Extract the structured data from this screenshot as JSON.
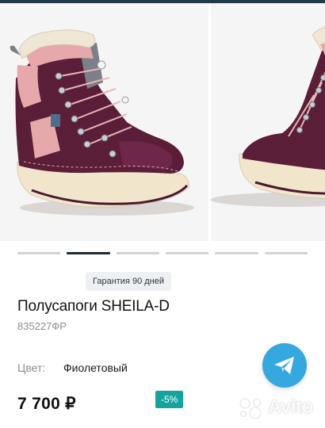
{
  "gallery": {
    "slide_count": 6,
    "active_index": 1
  },
  "badge": {
    "text": "Гарантия 90 дней"
  },
  "product": {
    "title": "Полусапоги SHEILA-D",
    "sku": "835227ФР",
    "color_label": "Цвет:",
    "color_value": "Фиолетовый",
    "price": "7 700 ₽",
    "discount": "-5%"
  },
  "actions": {
    "telegram_icon": "telegram-paper-plane-icon"
  },
  "watermark": {
    "text": "Avito"
  },
  "colors": {
    "accent_teal": "#15a3a0",
    "telegram_blue": "#35a8e0",
    "boot_purple": "#5b1e38",
    "boot_pink": "#e6a8ab",
    "sole_cream": "#f1e6cc"
  }
}
